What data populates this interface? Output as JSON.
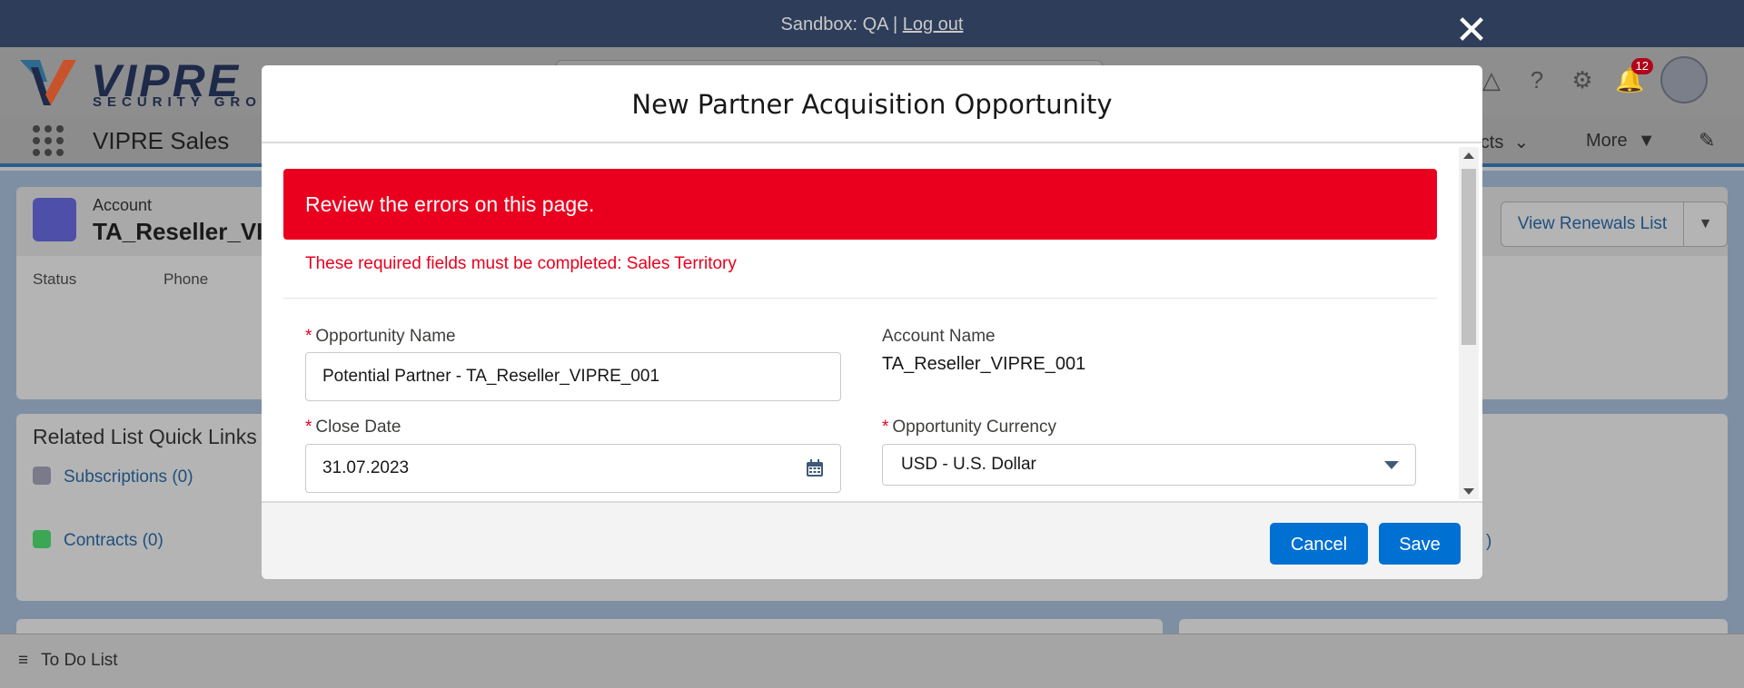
{
  "sandbox_bar": {
    "text": "Sandbox: QA |",
    "logout": "Log out"
  },
  "header": {
    "logo_word": "VIPRE",
    "logo_sub": "SECURITY GROUP",
    "notifications_count": "12"
  },
  "app_nav": {
    "app_name": "VIPRE Sales",
    "contracts_tab": "racts",
    "more_tab": "More"
  },
  "account": {
    "label": "Account",
    "name": "TA_Reseller_VI",
    "status_label": "Status",
    "phone_label": "Phone",
    "view_renewals": "View Renewals List"
  },
  "related": {
    "title": "Related List Quick Links",
    "items": [
      {
        "label": "Subscriptions (0)",
        "color": "#7a7a8a"
      },
      {
        "label": "Contracts (0)",
        "color": "#3ba755"
      }
    ],
    "right_partial": ")"
  },
  "utility": {
    "todo": "To Do List"
  },
  "modal": {
    "title": "New Partner Acquisition Opportunity",
    "error_banner": "Review the errors on this page.",
    "error_message": "These required fields must be completed: Sales Territory",
    "fields": {
      "opportunity_name_label": "Opportunity Name",
      "opportunity_name_value": "Potential Partner - TA_Reseller_VIPRE_001",
      "account_name_label": "Account Name",
      "account_name_value": "TA_Reseller_VIPRE_001",
      "close_date_label": "Close Date",
      "close_date_value": "31.07.2023",
      "currency_label": "Opportunity Currency",
      "currency_value": "USD - U.S. Dollar"
    },
    "required_marker": "*",
    "cancel": "Cancel",
    "save": "Save"
  },
  "colors": {
    "error": "#ea001e",
    "brand_button": "#0070d2"
  }
}
